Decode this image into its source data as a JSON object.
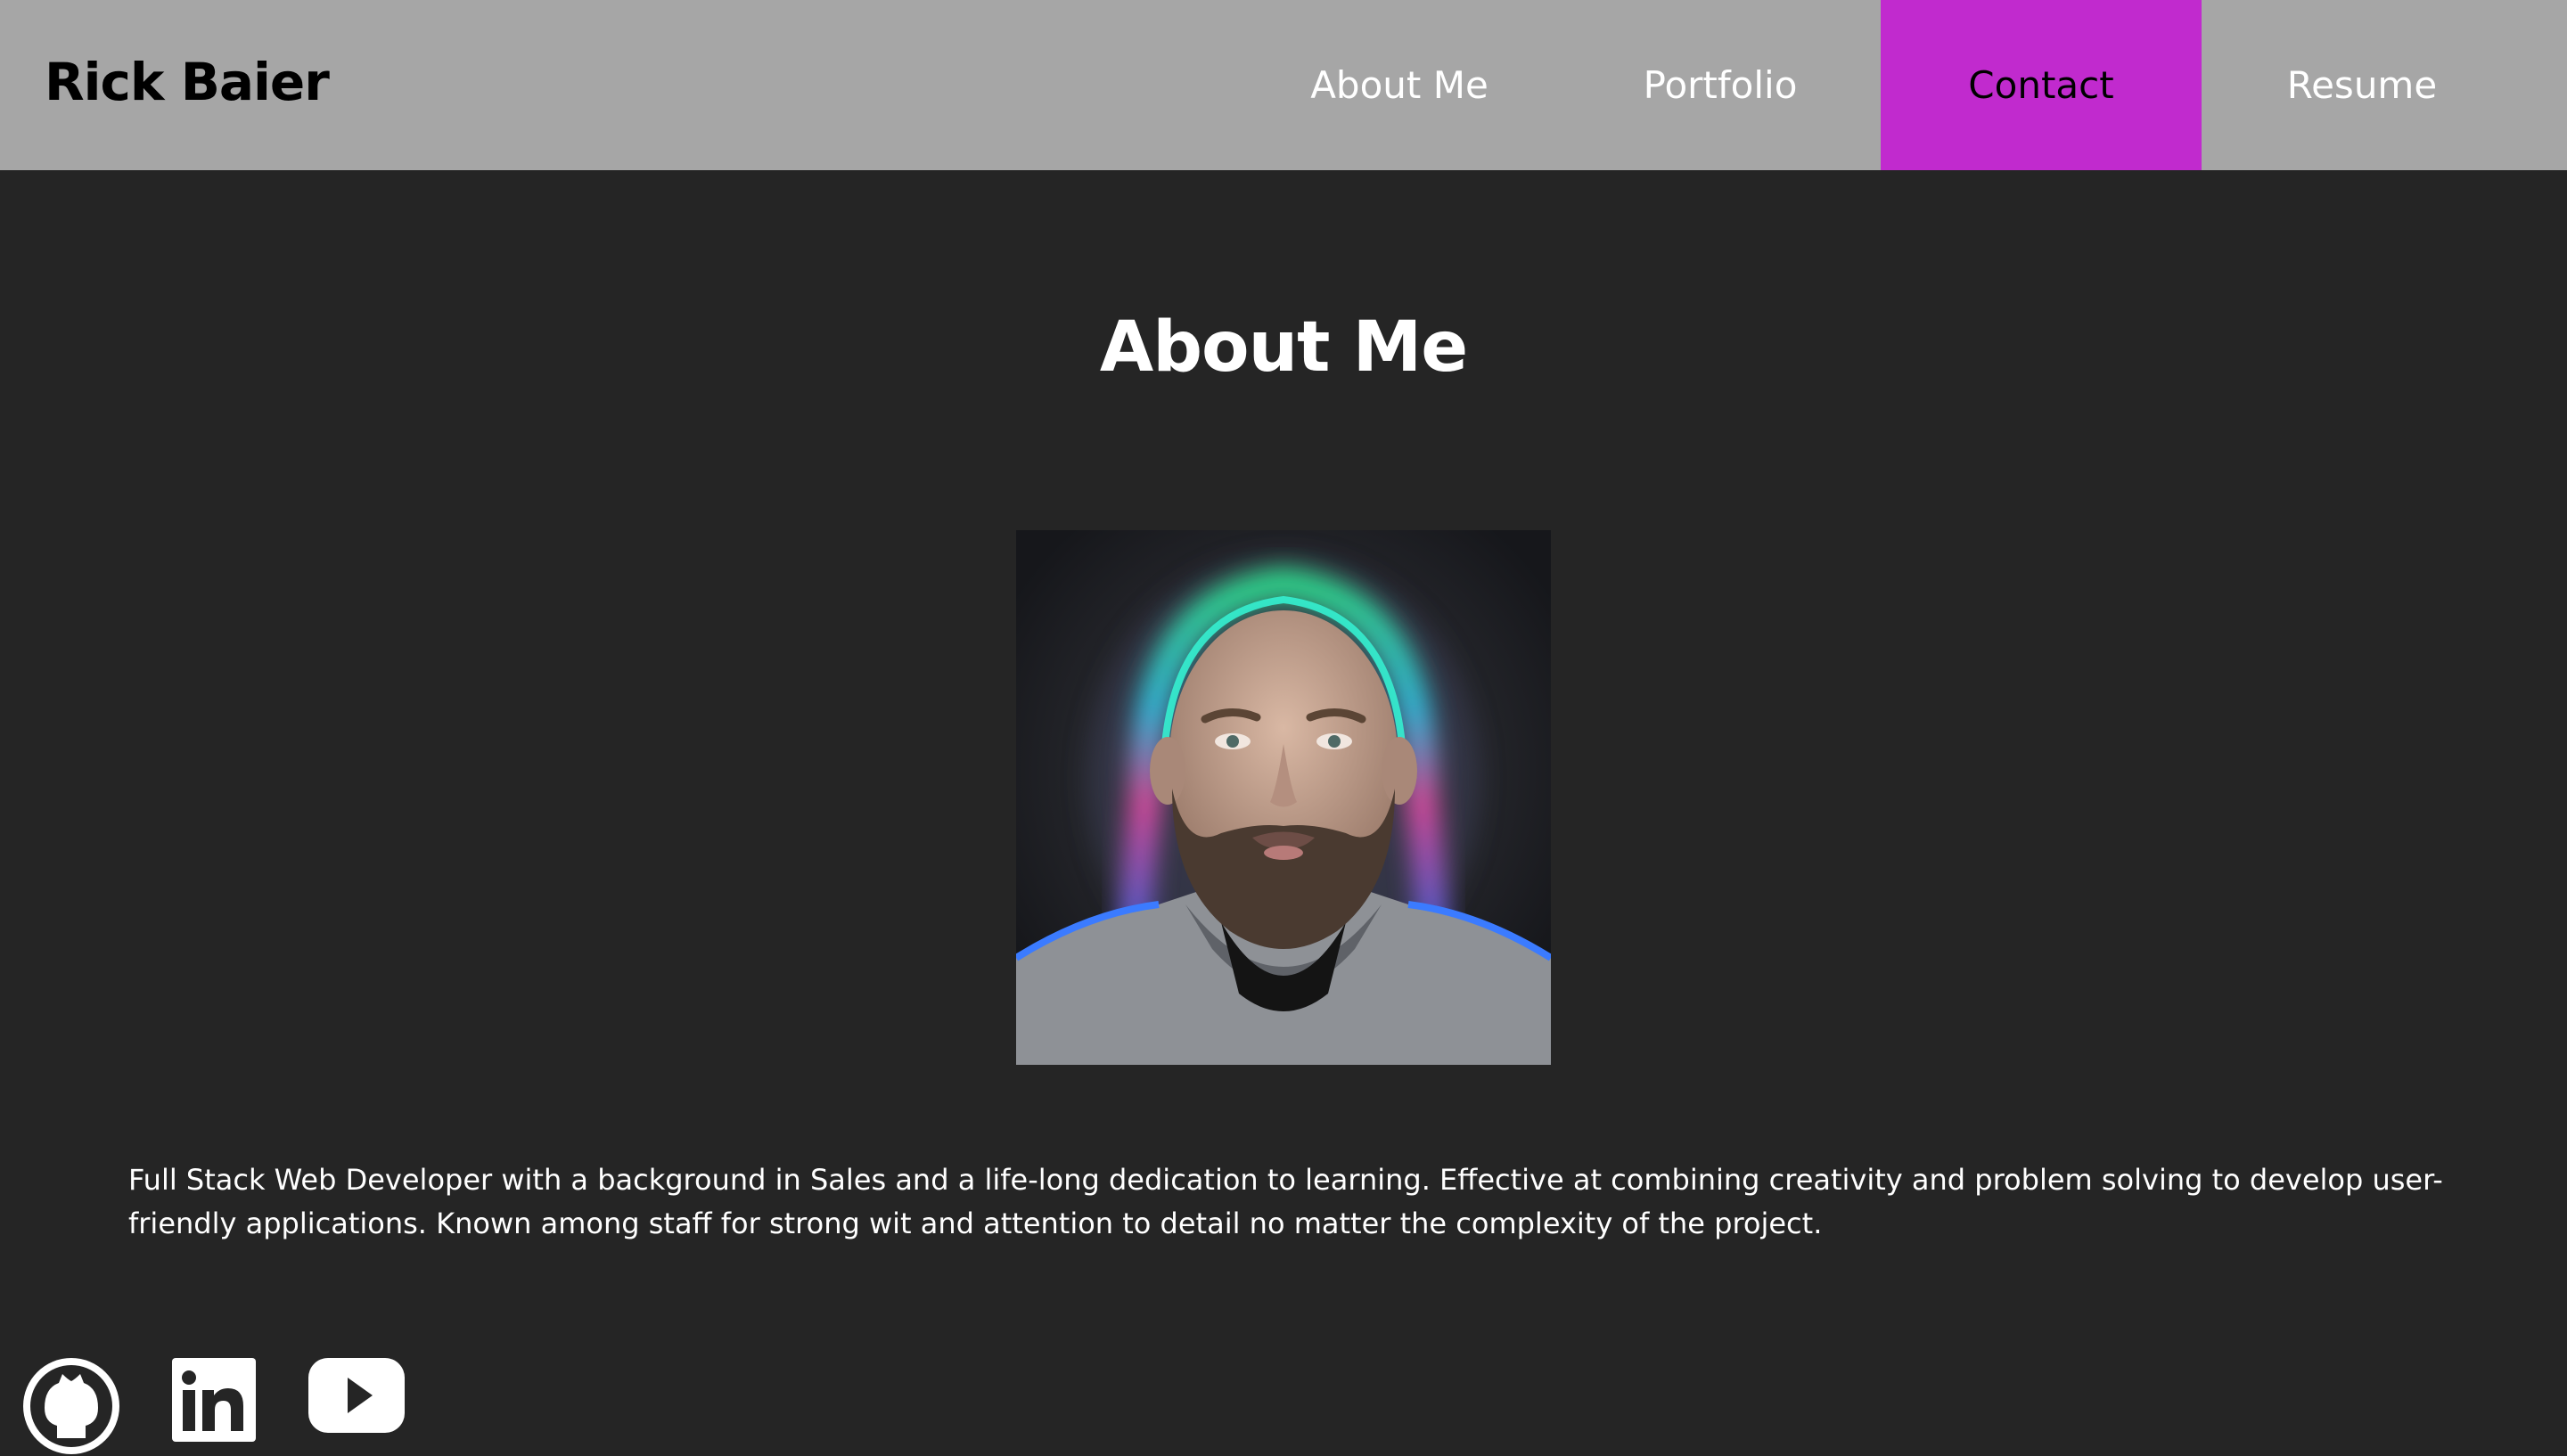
{
  "header": {
    "brand": "Rick Baier",
    "nav": [
      {
        "label": "About Me",
        "active": false
      },
      {
        "label": "Portfolio",
        "active": false
      },
      {
        "label": "Contact",
        "active": true
      },
      {
        "label": "Resume",
        "active": false
      }
    ]
  },
  "main": {
    "title": "About Me",
    "portrait_icon": "profile-photo",
    "bio": "Full Stack Web Developer with a background in Sales and a life-long dedication to learning. Effective at combining creativity and problem solving to develop user-friendly applications. Known among staff for strong wit and attention to detail no matter the complexity of the project."
  },
  "footer": {
    "social_icons": [
      "github-icon",
      "linkedin-icon",
      "youtube-icon"
    ]
  },
  "colors": {
    "header_bg": "#a6a6a6",
    "page_bg": "#252525",
    "accent": "#c12ace",
    "text": "#ffffff"
  }
}
